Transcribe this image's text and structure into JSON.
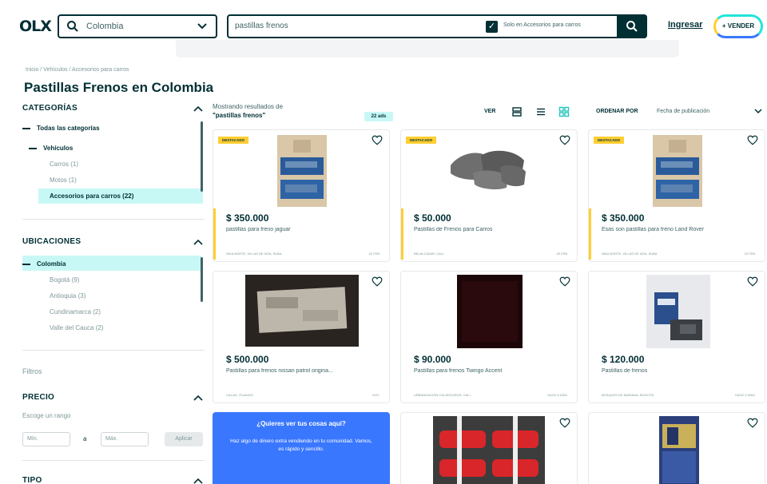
{
  "header": {
    "logo": "OLX",
    "location": "Colombia",
    "search_query": "pastillas frenos",
    "only_in_category_label": "Solo en Accesorios para carros",
    "only_in_category_checked": true,
    "login_label": "Ingresar",
    "sell_label": "+ VENDER"
  },
  "breadcrumb": "Inicio / Vehículos / Accesorios para carros",
  "page_title": "Pastillas Frenos en Colombia",
  "sidebar": {
    "categories_title": "CATEGORÍAS",
    "categories": [
      {
        "label": "Todas las categorías"
      },
      {
        "label": "Vehículos"
      },
      {
        "label": "Carros (1)"
      },
      {
        "label": "Motos (1)"
      },
      {
        "label": "Accesorios para carros (22)"
      }
    ],
    "locations_title": "UBICACIONES",
    "locations": [
      {
        "label": "Colombia"
      },
      {
        "label": "Bogotá (9)"
      },
      {
        "label": "Antioquia (3)"
      },
      {
        "label": "Cundinamarca (2)"
      },
      {
        "label": "Valle del Cauca (2)"
      }
    ],
    "filters_label": "Filtros",
    "price_title": "PRECIO",
    "price_hint": "Escoge un rango",
    "price_min_placeholder": "Mín.",
    "price_separator": "a",
    "price_max_placeholder": "Máx.",
    "apply_label": "Aplicar",
    "type_title": "TIPO"
  },
  "results": {
    "showing_prefix": "Mostrando resultados de",
    "query_quoted": "\"pastillas frenos\"",
    "ads_count": "22 ads",
    "view_label": "VER",
    "sort_label": "ORDENAR POR",
    "sort_value": "Fecha de publicación"
  },
  "listings": [
    {
      "featured": true,
      "badge": "DESTACADO",
      "price": "$ 350.000",
      "title": "pastillas para freno jaguar",
      "location": "NIKA NORTE, VILLAS DE NOA, SUBA",
      "date": "22 FEB"
    },
    {
      "featured": true,
      "badge": "DESTACADO",
      "price": "$ 50.000",
      "title": "Pastillas de Frenos para Carros",
      "location": "BELALCÁZAR, CALI",
      "date": "20 FEB"
    },
    {
      "featured": true,
      "badge": "DESTACADO",
      "price": "$ 350.000",
      "title": "Esas son pastillas para freno Land Rover",
      "location": "NIKA NORTE, VILLAS DE NOA, SUBA",
      "date": "22 FEB"
    },
    {
      "featured": false,
      "badge": "",
      "price": "$ 500.000",
      "title": "Pastillas para frenos nissan patrol origina...",
      "location": "VILLAS, ITUANGO",
      "date": "HOY"
    },
    {
      "featured": false,
      "badge": "",
      "price": "$ 90.000",
      "title": "Pastillas para frenos Twingo Accent",
      "location": "URBANIZACIÓN COLSEGUROS, CALI",
      "date": "HACE 5 DÍAS"
    },
    {
      "featured": false,
      "badge": "",
      "price": "$ 120.000",
      "title": "Pastillas de frenos",
      "location": "BOSQUES DE MARIANA, BOGOTÁ",
      "date": "HACE 5 DÍAS"
    }
  ],
  "promo": {
    "title": "¿Quieres ver tus cosas aquí?",
    "body": "Haz algo de dinero extra vendiendo en tu comunidad. Vamos, es rápido y sencillo."
  },
  "colors": {
    "primary": "#002f34",
    "teal": "#23e5db",
    "yellow": "#ffce32",
    "blue": "#3a77ff",
    "active_bg": "#c8f8f6"
  }
}
